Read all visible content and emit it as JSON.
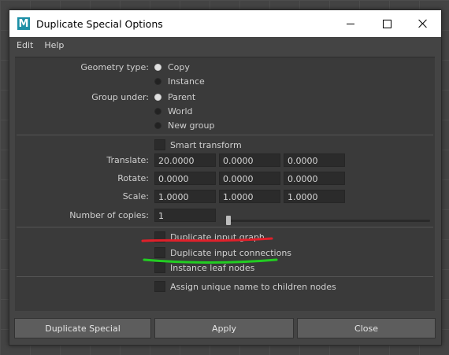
{
  "window": {
    "app_icon_letter": "M",
    "title": "Duplicate Special Options"
  },
  "menu": {
    "items": [
      "Edit",
      "Help"
    ]
  },
  "geometry_type": {
    "label": "Geometry type:",
    "options": [
      "Copy",
      "Instance"
    ],
    "selected": "Copy"
  },
  "group_under": {
    "label": "Group under:",
    "options": [
      "Parent",
      "World",
      "New group"
    ],
    "selected": "Parent"
  },
  "smart_transform": {
    "label": "Smart transform",
    "checked": false
  },
  "translate": {
    "label": "Translate:",
    "values": [
      "20.0000",
      "0.0000",
      "0.0000"
    ]
  },
  "rotate": {
    "label": "Rotate:",
    "values": [
      "0.0000",
      "0.0000",
      "0.0000"
    ]
  },
  "scale": {
    "label": "Scale:",
    "values": [
      "1.0000",
      "1.0000",
      "1.0000"
    ]
  },
  "number_of_copies": {
    "label": "Number of copies:",
    "value": "1"
  },
  "duplicate_input_graph": {
    "label": "Duplicate input graph",
    "checked": false
  },
  "duplicate_input_connections": {
    "label": "Duplicate input connections",
    "checked": false
  },
  "instance_leaf_nodes": {
    "label": "Instance leaf nodes",
    "checked": false
  },
  "assign_unique_name": {
    "label": "Assign unique name to children nodes",
    "checked": false
  },
  "annotations": {
    "red": "#e0202a",
    "green": "#22cc22"
  },
  "footer": {
    "duplicate_special": "Duplicate Special",
    "apply": "Apply",
    "close": "Close"
  }
}
